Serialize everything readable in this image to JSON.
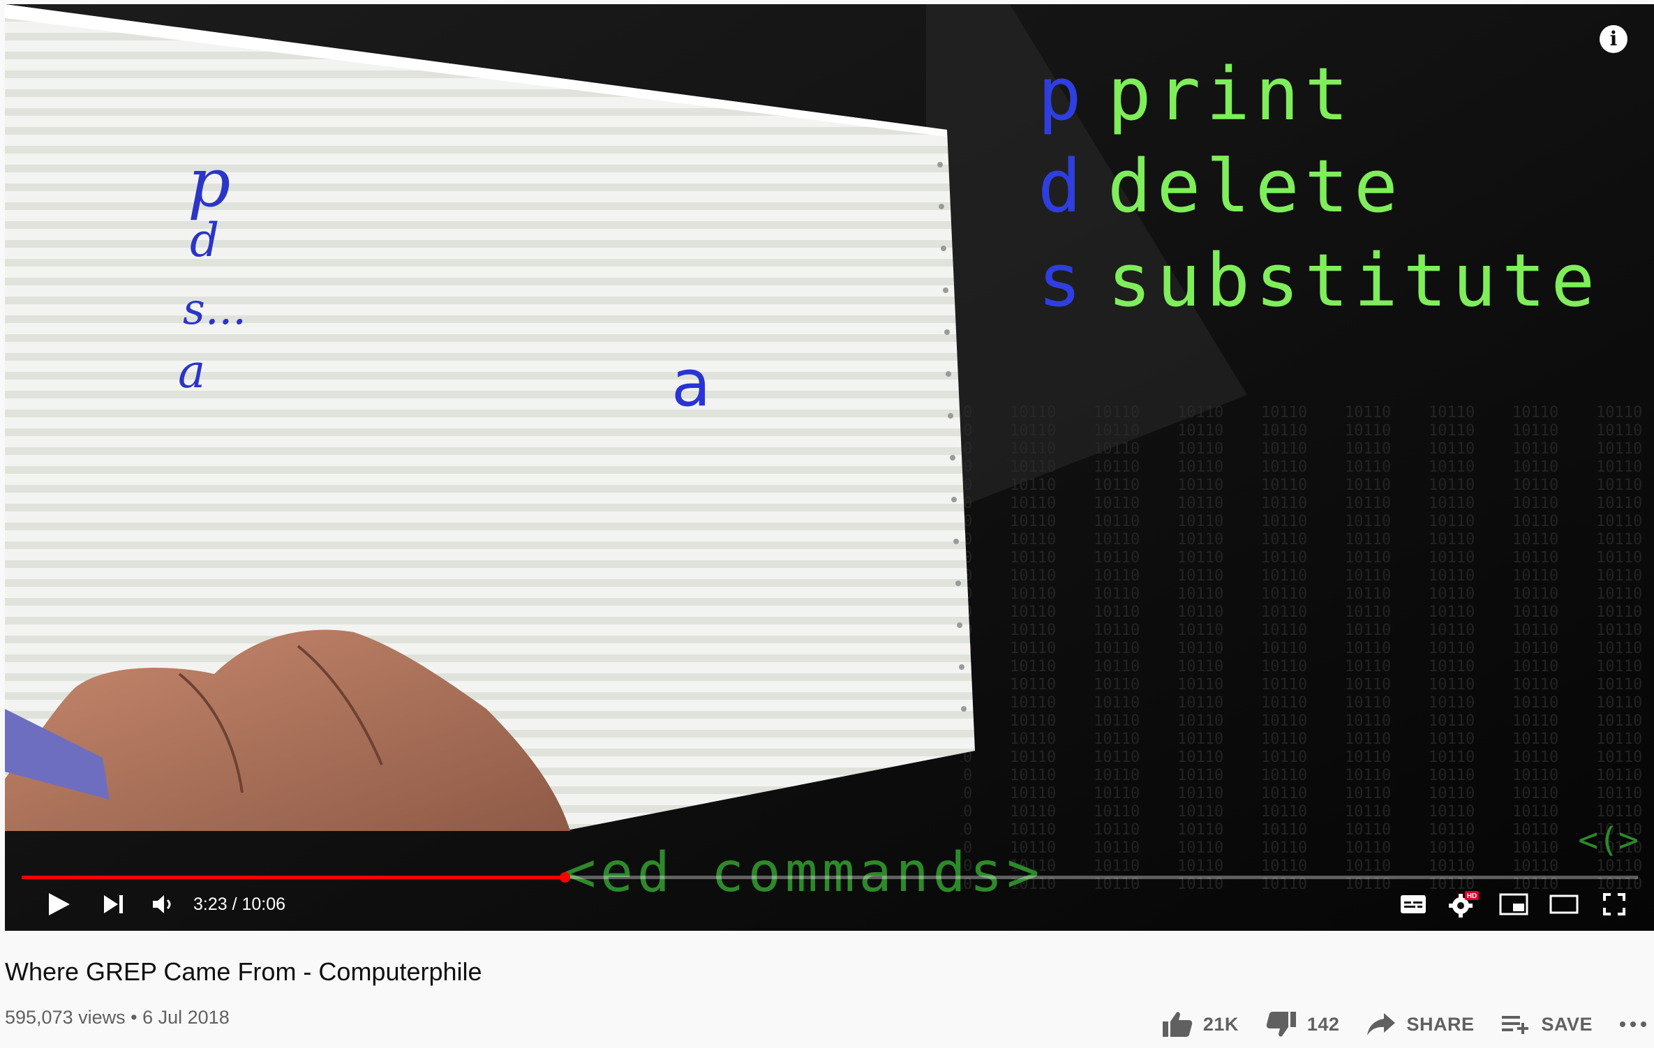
{
  "video": {
    "handwritten": [
      "p",
      "d",
      "s...",
      "a"
    ],
    "overlay_letter": "a",
    "commands": [
      {
        "letter": "p",
        "word": "print"
      },
      {
        "letter": "d",
        "word": "delete"
      },
      {
        "letter": "s",
        "word": "substitute"
      }
    ],
    "caption": "<ed commands>",
    "channel_mark": "<(>",
    "info_label": "i"
  },
  "player": {
    "current_time": "3:23",
    "duration": "10:06",
    "time_display": "3:23 / 10:06",
    "progress_fraction": 0.336,
    "hd_badge": "HD",
    "controls": [
      "play-icon",
      "next-icon",
      "volume-icon",
      "subtitles-icon",
      "settings-icon",
      "miniplayer-icon",
      "theater-icon",
      "fullscreen-icon"
    ]
  },
  "meta": {
    "title": "Where GREP Came From - Computerphile",
    "views": "595,073 views",
    "separator": "•",
    "date": "6 Jul 2018"
  },
  "actions": {
    "like_count": "21K",
    "dislike_count": "142",
    "share_label": "SHARE",
    "save_label": "SAVE"
  },
  "colors": {
    "progress": "#ff0000",
    "command_letter": "#2f3ee0",
    "command_word": "#7fee5a",
    "caption_green": "#2d8a2a"
  }
}
